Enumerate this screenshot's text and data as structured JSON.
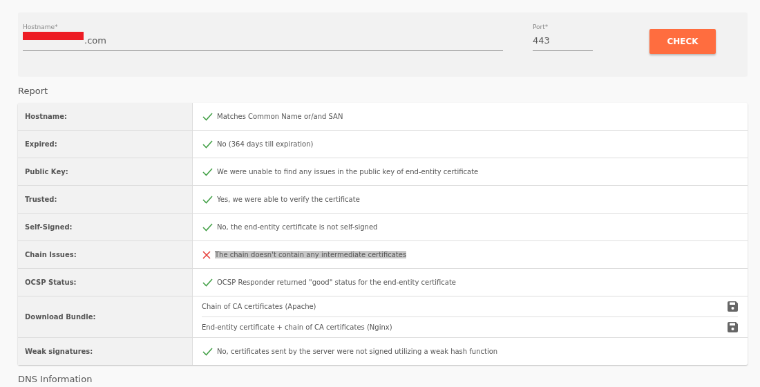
{
  "form": {
    "hostname": {
      "label": "Hostname*",
      "value": ".com",
      "redacted": true
    },
    "port": {
      "label": "Port*",
      "value": "443"
    },
    "button": "CHECK"
  },
  "report": {
    "title": "Report",
    "rows": [
      {
        "kind": "check",
        "label": "Hostname:",
        "passed": true,
        "text": "Matches Common Name or/and SAN",
        "highlighted": false
      },
      {
        "kind": "check",
        "label": "Expired:",
        "passed": true,
        "text": "No (364 days till expiration)",
        "highlighted": false
      },
      {
        "kind": "check",
        "label": "Public Key:",
        "passed": true,
        "text": "We were unable to find any issues in the public key of end-entity certificate",
        "highlighted": false
      },
      {
        "kind": "check",
        "label": "Trusted:",
        "passed": true,
        "text": "Yes, we were able to verify the certificate",
        "highlighted": false
      },
      {
        "kind": "check",
        "label": "Self-Signed:",
        "passed": true,
        "text": "No, the end-entity certificate is not self-signed",
        "highlighted": false
      },
      {
        "kind": "check",
        "label": "Chain Issues:",
        "passed": false,
        "text": "The chain doesn't contain any intermediate certificates",
        "highlighted": true
      },
      {
        "kind": "check",
        "label": "OCSP Status:",
        "passed": true,
        "text": "OCSP Responder returned \"good\" status for the end-entity certificate",
        "highlighted": false
      },
      {
        "kind": "downloads",
        "label": "Download Bundle:",
        "items": [
          "Chain of CA certificates (Apache)",
          "End-entity certificate + chain of CA certificates (Nginx)"
        ]
      },
      {
        "kind": "check",
        "label": "Weak signatures:",
        "passed": true,
        "text": "No, certificates sent by the server were not signed utilizing a weak hash function",
        "highlighted": false
      }
    ]
  },
  "dns": {
    "title": "DNS Information"
  }
}
